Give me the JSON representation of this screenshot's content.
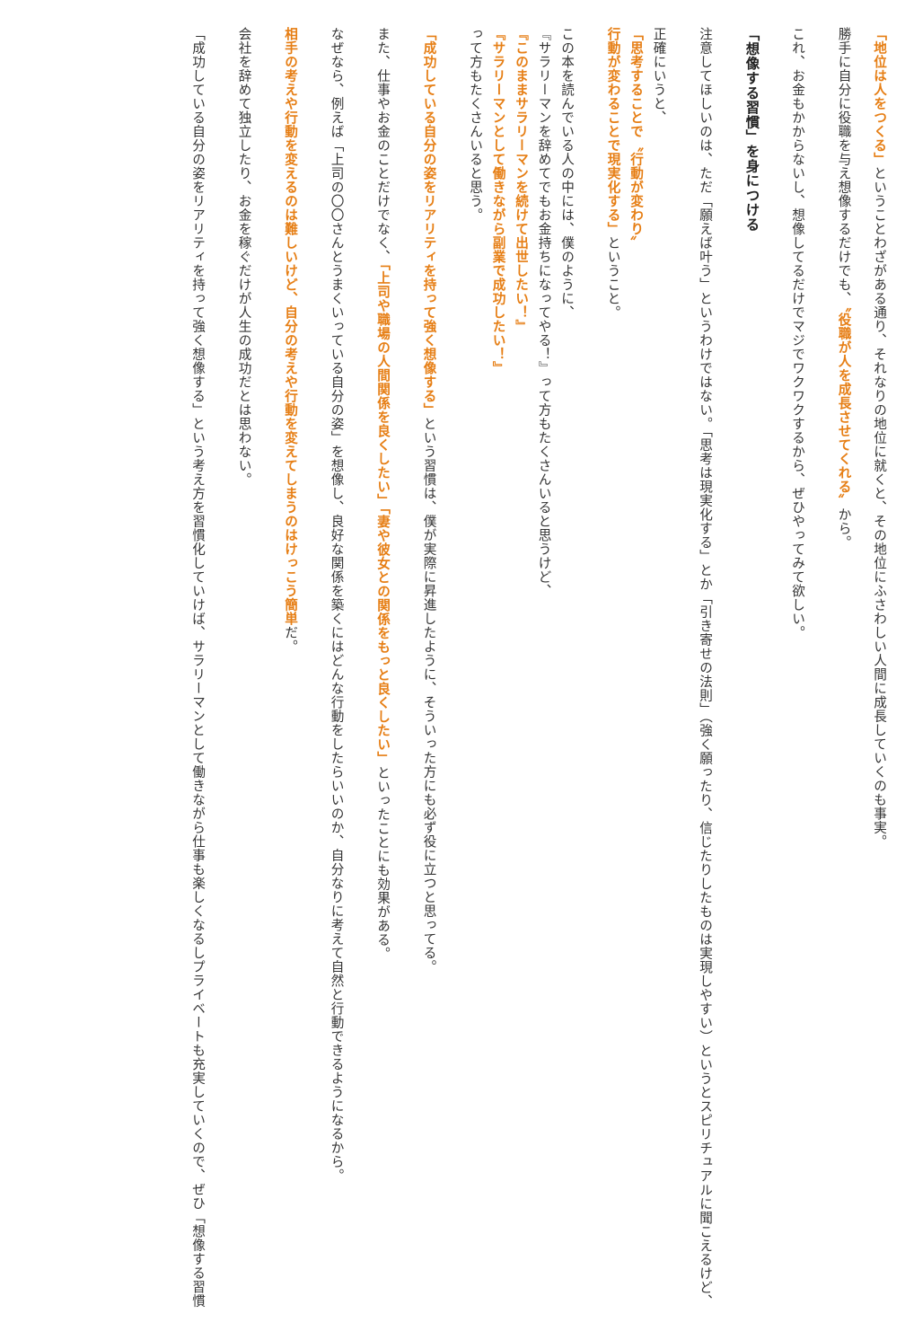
{
  "article": {
    "p1": {
      "hl1": "「地位は人をつくる」",
      "t1": "ということわざがある通り、それなりの地位に就くと、その地位にふさわしい人間に成長していくのも事実。"
    },
    "p2": {
      "t1": "勝手に自分に役職を与え想像するだけでも、",
      "hl1": "〝役職が人を成長させてくれる〟",
      "t2": "から。"
    },
    "p3": {
      "t1": "これ、お金もかからないし、想像してるだけでマジでワクワクするから、ぜひやってみて欲しい。"
    },
    "heading": "「想像する習慣」を身につける",
    "p4": {
      "t1": "注意してほしいのは、ただ「願えば叶う」というわけではない。「思考は現実化する」とか「引き寄せの法則」（強く願ったり、信じたりしたものは実現しやすい）というとスピリチュアルに聞こえるけど、"
    },
    "p5": {
      "t1": "正確にいうと、",
      "hl1": "「思考することで〝行動が変わり〟",
      "hl2": "行動が変わることで現実化する」",
      "t2": "ということ。"
    },
    "p6": {
      "t1": "この本を読んでいる人の中には、僕のように、",
      "t2": "『サラリーマンを辞めてでもお金持ちになってやる！』って方もたくさんいると思うけど、",
      "hl1": "『このままサラリーマンを続けて出世したい！』",
      "hl2": "『サラリーマンとして働きながら副業で成功したい！』",
      "t3": "って方もたくさんいると思う。"
    },
    "p7": {
      "hl1": "「成功している自分の姿をリアリティを持って強く想像する」",
      "t1": "という習慣は、僕が実際に昇進したように、そういった方にも必ず役に立つと思ってる。"
    },
    "p8": {
      "t1": "また、仕事やお金のことだけでなく、",
      "hl1": "「上司や職場の人間関係を良くしたい」「妻や彼女との関係をもっと良くしたい」",
      "t2": "といったことにも効果がある。"
    },
    "p9": {
      "t1": "なぜなら、例えば「上司の〇〇さんとうまくいっている自分の姿」を想像し、良好な関係を築くにはどんな行動をしたらいいのか、自分なりに考えて自然と行動できるようになるから。"
    },
    "p10": {
      "hl1": "相手の考えや行動を変えるのは難しいけど、自分の考えや行動を変えてしまうのはけっこう簡単",
      "t1": "だ。"
    },
    "p11": {
      "t1": "会社を辞めて独立したり、お金を稼ぐだけが人生の成功だとは思わない。"
    },
    "p12": {
      "t1": "「成功している自分の姿をリアリティを持って強く想像する」という考え方を習慣化していけば、サラリーマンとして働きながら仕事も楽しくなるしプライベートも充実していくので、ぜひ「想像する習慣"
    }
  },
  "colors": {
    "text": "#333333",
    "highlight": "#e67e14",
    "heading": "#222222",
    "background": "#ffffff"
  }
}
